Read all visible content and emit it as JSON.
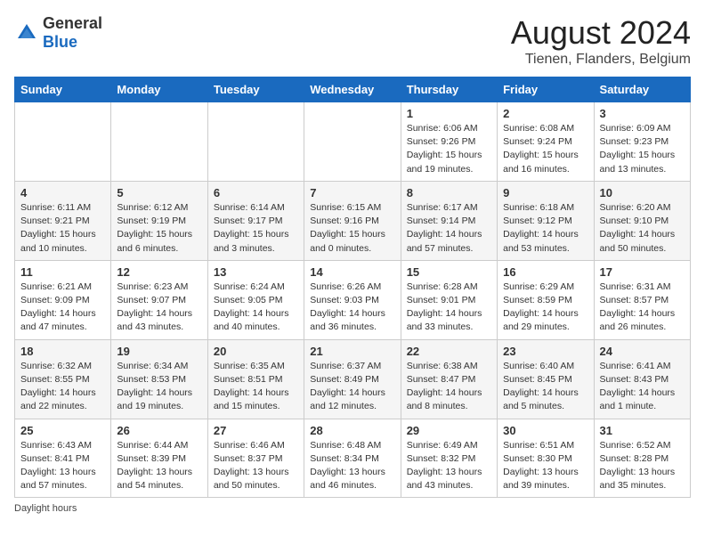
{
  "logo": {
    "general": "General",
    "blue": "Blue"
  },
  "title": "August 2024",
  "subtitle": "Tienen, Flanders, Belgium",
  "days_of_week": [
    "Sunday",
    "Monday",
    "Tuesday",
    "Wednesday",
    "Thursday",
    "Friday",
    "Saturday"
  ],
  "weeks": [
    [
      {
        "day": "",
        "info": ""
      },
      {
        "day": "",
        "info": ""
      },
      {
        "day": "",
        "info": ""
      },
      {
        "day": "",
        "info": ""
      },
      {
        "day": "1",
        "info": "Sunrise: 6:06 AM\nSunset: 9:26 PM\nDaylight: 15 hours\nand 19 minutes."
      },
      {
        "day": "2",
        "info": "Sunrise: 6:08 AM\nSunset: 9:24 PM\nDaylight: 15 hours\nand 16 minutes."
      },
      {
        "day": "3",
        "info": "Sunrise: 6:09 AM\nSunset: 9:23 PM\nDaylight: 15 hours\nand 13 minutes."
      }
    ],
    [
      {
        "day": "4",
        "info": "Sunrise: 6:11 AM\nSunset: 9:21 PM\nDaylight: 15 hours\nand 10 minutes."
      },
      {
        "day": "5",
        "info": "Sunrise: 6:12 AM\nSunset: 9:19 PM\nDaylight: 15 hours\nand 6 minutes."
      },
      {
        "day": "6",
        "info": "Sunrise: 6:14 AM\nSunset: 9:17 PM\nDaylight: 15 hours\nand 3 minutes."
      },
      {
        "day": "7",
        "info": "Sunrise: 6:15 AM\nSunset: 9:16 PM\nDaylight: 15 hours\nand 0 minutes."
      },
      {
        "day": "8",
        "info": "Sunrise: 6:17 AM\nSunset: 9:14 PM\nDaylight: 14 hours\nand 57 minutes."
      },
      {
        "day": "9",
        "info": "Sunrise: 6:18 AM\nSunset: 9:12 PM\nDaylight: 14 hours\nand 53 minutes."
      },
      {
        "day": "10",
        "info": "Sunrise: 6:20 AM\nSunset: 9:10 PM\nDaylight: 14 hours\nand 50 minutes."
      }
    ],
    [
      {
        "day": "11",
        "info": "Sunrise: 6:21 AM\nSunset: 9:09 PM\nDaylight: 14 hours\nand 47 minutes."
      },
      {
        "day": "12",
        "info": "Sunrise: 6:23 AM\nSunset: 9:07 PM\nDaylight: 14 hours\nand 43 minutes."
      },
      {
        "day": "13",
        "info": "Sunrise: 6:24 AM\nSunset: 9:05 PM\nDaylight: 14 hours\nand 40 minutes."
      },
      {
        "day": "14",
        "info": "Sunrise: 6:26 AM\nSunset: 9:03 PM\nDaylight: 14 hours\nand 36 minutes."
      },
      {
        "day": "15",
        "info": "Sunrise: 6:28 AM\nSunset: 9:01 PM\nDaylight: 14 hours\nand 33 minutes."
      },
      {
        "day": "16",
        "info": "Sunrise: 6:29 AM\nSunset: 8:59 PM\nDaylight: 14 hours\nand 29 minutes."
      },
      {
        "day": "17",
        "info": "Sunrise: 6:31 AM\nSunset: 8:57 PM\nDaylight: 14 hours\nand 26 minutes."
      }
    ],
    [
      {
        "day": "18",
        "info": "Sunrise: 6:32 AM\nSunset: 8:55 PM\nDaylight: 14 hours\nand 22 minutes."
      },
      {
        "day": "19",
        "info": "Sunrise: 6:34 AM\nSunset: 8:53 PM\nDaylight: 14 hours\nand 19 minutes."
      },
      {
        "day": "20",
        "info": "Sunrise: 6:35 AM\nSunset: 8:51 PM\nDaylight: 14 hours\nand 15 minutes."
      },
      {
        "day": "21",
        "info": "Sunrise: 6:37 AM\nSunset: 8:49 PM\nDaylight: 14 hours\nand 12 minutes."
      },
      {
        "day": "22",
        "info": "Sunrise: 6:38 AM\nSunset: 8:47 PM\nDaylight: 14 hours\nand 8 minutes."
      },
      {
        "day": "23",
        "info": "Sunrise: 6:40 AM\nSunset: 8:45 PM\nDaylight: 14 hours\nand 5 minutes."
      },
      {
        "day": "24",
        "info": "Sunrise: 6:41 AM\nSunset: 8:43 PM\nDaylight: 14 hours\nand 1 minute."
      }
    ],
    [
      {
        "day": "25",
        "info": "Sunrise: 6:43 AM\nSunset: 8:41 PM\nDaylight: 13 hours\nand 57 minutes."
      },
      {
        "day": "26",
        "info": "Sunrise: 6:44 AM\nSunset: 8:39 PM\nDaylight: 13 hours\nand 54 minutes."
      },
      {
        "day": "27",
        "info": "Sunrise: 6:46 AM\nSunset: 8:37 PM\nDaylight: 13 hours\nand 50 minutes."
      },
      {
        "day": "28",
        "info": "Sunrise: 6:48 AM\nSunset: 8:34 PM\nDaylight: 13 hours\nand 46 minutes."
      },
      {
        "day": "29",
        "info": "Sunrise: 6:49 AM\nSunset: 8:32 PM\nDaylight: 13 hours\nand 43 minutes."
      },
      {
        "day": "30",
        "info": "Sunrise: 6:51 AM\nSunset: 8:30 PM\nDaylight: 13 hours\nand 39 minutes."
      },
      {
        "day": "31",
        "info": "Sunrise: 6:52 AM\nSunset: 8:28 PM\nDaylight: 13 hours\nand 35 minutes."
      }
    ]
  ],
  "footer_note": "Daylight hours"
}
